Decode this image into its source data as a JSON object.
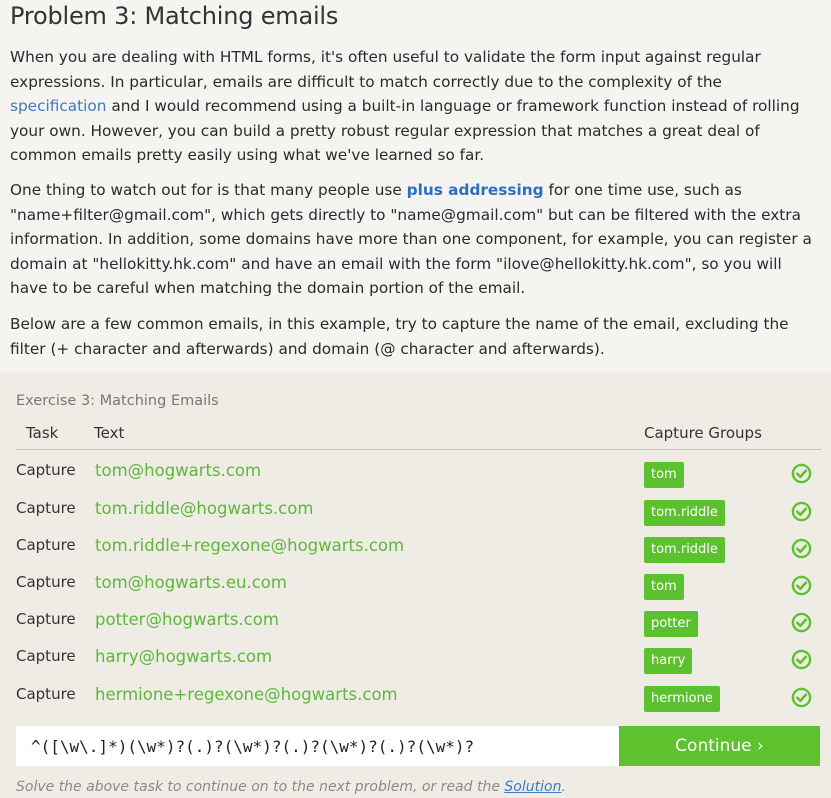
{
  "title": "Problem 3: Matching emails",
  "p1": {
    "before": "When you are dealing with HTML forms, it's often useful to validate the form input against regular expressions. In particular, emails are difficult to match correctly due to the complexity of the ",
    "link": "specification",
    "after": " and I would recommend using a built-in language or framework function instead of rolling your own. However, you can build a pretty robust regular expression that matches a great deal of common emails pretty easily using what we've learned so far."
  },
  "p2": {
    "before": "One thing to watch out for is that many people use ",
    "link": "plus addressing",
    "after": " for one time use, such as \"name+filter@gmail.com\", which gets directly to \"name@gmail.com\" but can be filtered with the extra information. In addition, some domains have more than one component, for example, you can register a domain at \"hellokitty.hk.com\" and have an email with the form \"ilove@hellokitty.hk.com\", so you will have to be careful when matching the domain portion of the email."
  },
  "p3": "Below are a few common emails, in this example, try to capture the name of the email, excluding the filter (+ character and afterwards) and domain (@ character and afterwards).",
  "exercise": {
    "title": "Exercise 3: Matching Emails",
    "headers": {
      "task": "Task",
      "text": "Text",
      "capture": "Capture Groups"
    },
    "rows": [
      {
        "task": "Capture",
        "text": "tom@hogwarts.com",
        "group": "tom"
      },
      {
        "task": "Capture",
        "text": "tom.riddle@hogwarts.com",
        "group": "tom.riddle"
      },
      {
        "task": "Capture",
        "text": "tom.riddle+regexone@hogwarts.com",
        "group": "tom.riddle"
      },
      {
        "task": "Capture",
        "text": "tom@hogwarts.eu.com",
        "group": "tom"
      },
      {
        "task": "Capture",
        "text": "potter@hogwarts.com",
        "group": "potter"
      },
      {
        "task": "Capture",
        "text": "harry@hogwarts.com",
        "group": "harry"
      },
      {
        "task": "Capture",
        "text": "hermione+regexone@hogwarts.com",
        "group": "hermione"
      }
    ],
    "answer": "^([\\w\\.]*)(\\w*)?(.)?(\\w*)?(.)?(\\w*)?(.)?(\\w*)?",
    "continue_label": "Continue ›",
    "footer_before": "Solve the above task to continue on to the next problem, or read the ",
    "footer_link": "Solution",
    "footer_after": "."
  },
  "colors": {
    "accent": "#5ec22e",
    "link": "#3b7bbf",
    "match_text": "#5cb83a"
  },
  "icons": {
    "row_status": "check-circle-icon"
  }
}
